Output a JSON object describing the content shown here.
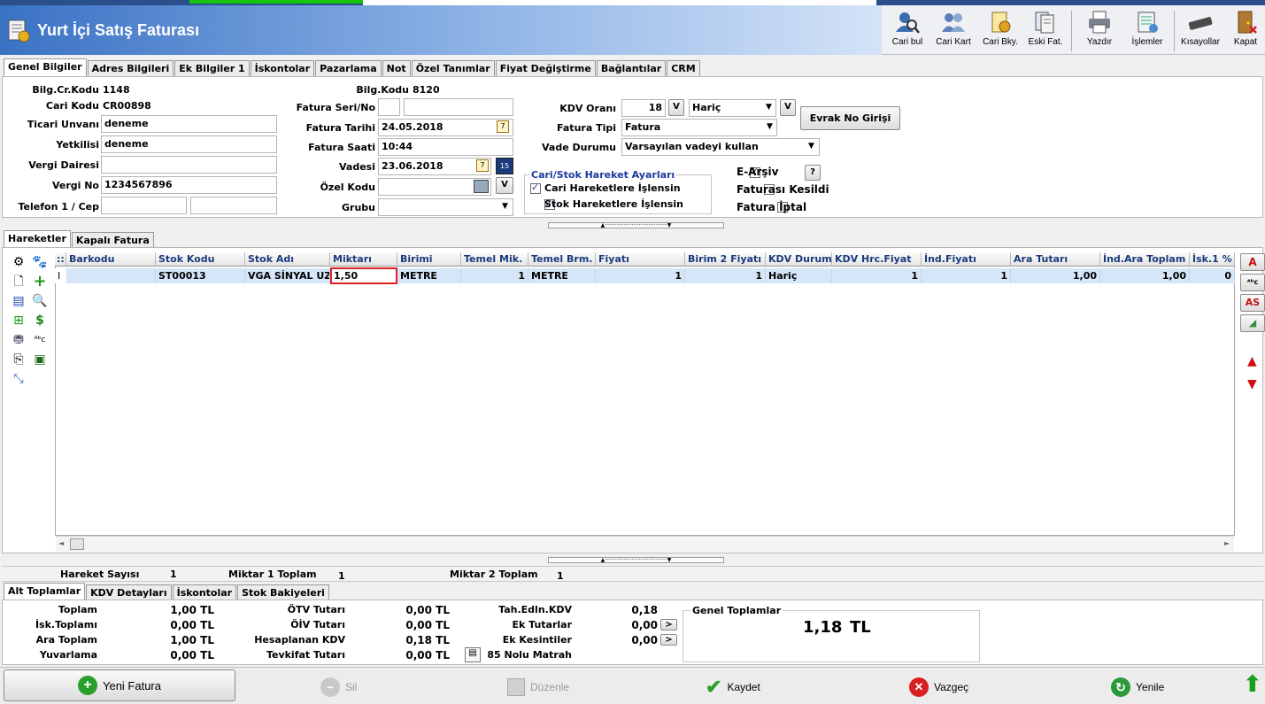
{
  "window": {
    "title": "Yurt İçi Satış Faturası"
  },
  "toolbar": {
    "items": [
      {
        "label": "Cari bul",
        "icon": "search-user-icon"
      },
      {
        "label": "Cari Kart",
        "icon": "users-card-icon"
      },
      {
        "label": "Cari Bky.",
        "icon": "balance-icon"
      },
      {
        "label": "Eski Fat.",
        "icon": "old-invoice-icon"
      },
      {
        "label": "Yazdır",
        "icon": "printer-icon"
      },
      {
        "label": "İşlemler",
        "icon": "operations-icon"
      },
      {
        "label": "Kısayollar",
        "icon": "keyboard-icon"
      },
      {
        "label": "Kapat",
        "icon": "exit-door-icon"
      }
    ]
  },
  "top_tabs": [
    "Genel Bilgiler",
    "Adres Bilgileri",
    "Ek Bilgiler 1",
    "İskontolar",
    "Pazarlama",
    "Not",
    "Özel Tanımlar",
    "Fiyat Değiştirme",
    "Bağlantılar",
    "CRM"
  ],
  "form": {
    "bilg_cr_kodu_label": "Bilg.Cr.Kodu",
    "bilg_cr_kodu": "1148",
    "cari_kodu_label": "Cari Kodu",
    "cari_kodu": "CR00898",
    "ticari_unvani_label": "Ticari Unvanı",
    "ticari_unvani": "deneme",
    "yetkilisi_label": "Yetkilisi",
    "yetkilisi": "deneme",
    "vergi_dairesi_label": "Vergi Dairesi",
    "vergi_dairesi": "",
    "vergi_no_label": "Vergi No",
    "vergi_no": "1234567896",
    "telefon_label": "Telefon 1 / Cep",
    "telefon1": "",
    "cep": "",
    "bilg_kodu_label": "Bilg.Kodu",
    "bilg_kodu": "8120",
    "fatura_seri_no_label": "Fatura Seri/No",
    "fatura_seri": "",
    "fatura_no": "",
    "fatura_tarihi_label": "Fatura Tarihi",
    "fatura_tarihi": "24.05.2018",
    "fatura_saati_label": "Fatura Saati",
    "fatura_saati": "10:44",
    "vadesi_label": "Vadesi",
    "vadesi": "23.06.2018",
    "ozel_kodu_label": "Özel Kodu",
    "ozel_kodu": "",
    "grubu_label": "Grubu",
    "grubu": "",
    "kdv_orani_label": "KDV Oranı",
    "kdv_orani": "18",
    "kdv_dahil": "Hariç",
    "fatura_tipi_label": "Fatura Tipi",
    "fatura_tipi": "Fatura",
    "vade_durumu_label": "Vade Durumu",
    "vade_durumu": "Varsayılan vadeyi kullan",
    "evrak_no_button": "Evrak No Girişi",
    "v_button": "V",
    "help_button": "?",
    "hareket_group_title": "Cari/Stok Hareket Ayarları",
    "cari_hareket_label": "Cari Hareketlere İşlensin",
    "stok_hareket_label": "Stok Hareketlere İşlensin",
    "e_arsiv_label": "E-Arşiv",
    "faturasi_kesildi_label": "Faturası Kesildi",
    "fatura_iptal_label": "Fatura İptal",
    "cari_hareket_checked": true,
    "stok_hareket_checked": true,
    "e_arsiv_checked": true,
    "faturasi_kesildi_checked": false,
    "fatura_iptal_checked": false
  },
  "mid_tabs": [
    "Hareketler",
    "Kapalı Fatura"
  ],
  "grid": {
    "columns": [
      "Barkodu",
      "Stok Kodu",
      "Stok Adı",
      "Miktarı",
      "Birimi",
      "Temel Mik.",
      "Temel Brm.",
      "Fiyatı",
      "Birim 2 Fiyatı",
      "KDV Durumu",
      "KDV Hrc.Fiyat",
      "İnd.Fiyatı",
      "Ara Tutarı",
      "İnd.Ara Toplam",
      "İsk.1 %"
    ],
    "rows": [
      [
        "",
        "ST00013",
        "VGA SİNYAL UZA",
        "1,50",
        "METRE",
        "1",
        "METRE",
        "1",
        "1",
        "Hariç",
        "1",
        "1",
        "1,00",
        "1,00",
        "0"
      ]
    ],
    "row_indicator": "I",
    "side_buttons": [
      "A",
      "AS"
    ]
  },
  "summary_bar": {
    "hareket_sayisi_label": "Hareket Sayısı",
    "hareket_sayisi": "1",
    "miktar1_label": "Miktar 1 Toplam",
    "miktar1": "1",
    "miktar2_label": "Miktar 2 Toplam",
    "miktar2": "1"
  },
  "bottom_tabs": [
    "Alt Toplamlar",
    "KDV Detayları",
    "İskontolar",
    "Stok Bakiyeleri"
  ],
  "totals": {
    "col1": [
      {
        "label": "Toplam",
        "value": "1,00 TL"
      },
      {
        "label": "İsk.Toplamı",
        "value": "0,00 TL"
      },
      {
        "label": "Ara Toplam",
        "value": "1,00 TL"
      },
      {
        "label": "Yuvarlama",
        "value": "0,00 TL"
      }
    ],
    "col2": [
      {
        "label": "ÖTV Tutarı",
        "value": "0,00 TL"
      },
      {
        "label": "ÖİV Tutarı",
        "value": "0,00 TL"
      },
      {
        "label": "Hesaplanan KDV",
        "value": "0,18 TL"
      },
      {
        "label": "Tevkifat Tutarı",
        "value": "0,00 TL"
      }
    ],
    "col3": [
      {
        "label": "Tah.Edln.KDV",
        "value": "0,18"
      },
      {
        "label": "Ek Tutarlar",
        "value": "0,00"
      },
      {
        "label": "Ek Kesintiler",
        "value": "0,00"
      },
      {
        "label": "85 Nolu Matrah",
        "value": ""
      }
    ],
    "arrow_button": ">",
    "genel_toplamlar_label": "Genel Toplamlar",
    "genel_toplam_value": "1,18",
    "genel_toplam_unit": "TL"
  },
  "footer": {
    "yeni_fatura": "Yeni Fatura",
    "sil": "Sil",
    "duzenle": "Düzenle",
    "kaydet": "Kaydet",
    "vazgec": "Vazgeç",
    "yenile": "Yenile"
  },
  "colors": {
    "title_blue": "#3a72c4",
    "row_selected": "#d6e6fa",
    "highlight_border": "#e02020",
    "header_text": "#1a3a7c"
  }
}
